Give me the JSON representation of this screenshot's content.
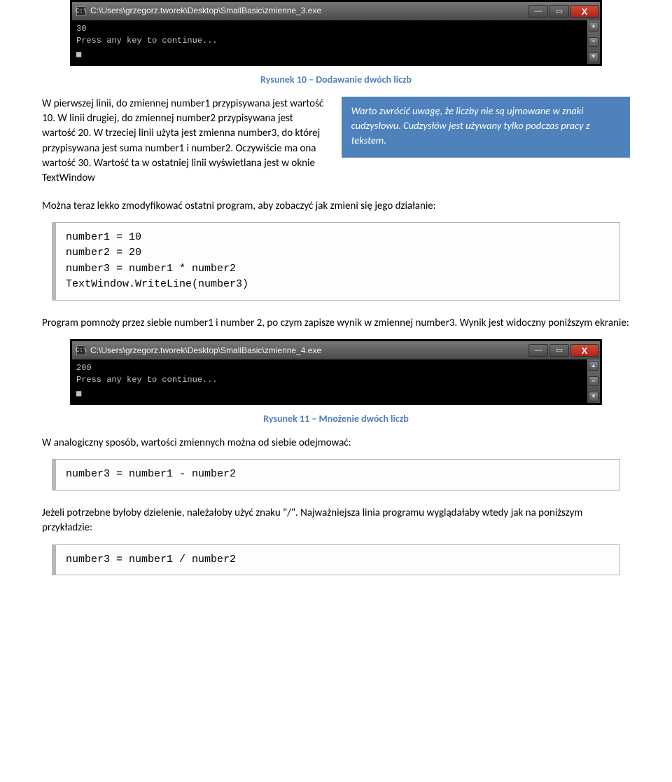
{
  "console1": {
    "title": "C:\\Users\\grzegorz.tworek\\Desktop\\SmallBasic\\zmienne_3.exe",
    "line1": "30",
    "line2": "Press any key to continue..."
  },
  "caption1": "Rysunek 10 – Dodawanie dwóch liczb",
  "para1_left": "W pierwszej linii, do zmiennej number1 przypisywana jest wartość 10. W linii drugiej, do zmiennej number2 przypisywana jest wartość 20. W trzeciej linii użyta jest zmienna number3, do której przypisywana jest suma number1 i number2. Oczywiście ma ona wartość 30. Wartość ta w ostatniej linii wyświetlana jest w oknie TextWindow",
  "tip": "Warto zwrócić uwagę, że liczby nie są ujmowane w znaki cudzysłowu. Cudzysłów jest używany tylko podczas pracy z tekstem.",
  "para2": "Można teraz lekko zmodyfikować ostatni program, aby zobaczyć jak zmieni się jego działanie:",
  "code1": "number1 = 10\nnumber2 = 20\nnumber3 = number1 * number2\nTextWindow.WriteLine(number3)",
  "para3": "Program pomnoży przez siebie number1 i number 2, po czym zapisze wynik w zmiennej number3. Wynik jest widoczny poniższym ekranie:",
  "console2": {
    "title": "C:\\Users\\grzegorz.tworek\\Desktop\\SmallBasic\\zmienne_4.exe",
    "line1": "200",
    "line2": "Press any key to continue..."
  },
  "caption2": "Rysunek 11 – Mnożenie dwóch liczb",
  "para4": "W analogiczny sposób, wartości zmiennych można od siebie odejmować:",
  "code2": "number3 = number1 - number2",
  "para5": "Jeżeli potrzebne byłoby dzielenie, należałoby użyć znaku \"/\". Najważniejsza linia programu wyglądałaby wtedy jak na poniższym przykładzie:",
  "code3": "number3 = number1 / number2",
  "win_btn_close": "X"
}
